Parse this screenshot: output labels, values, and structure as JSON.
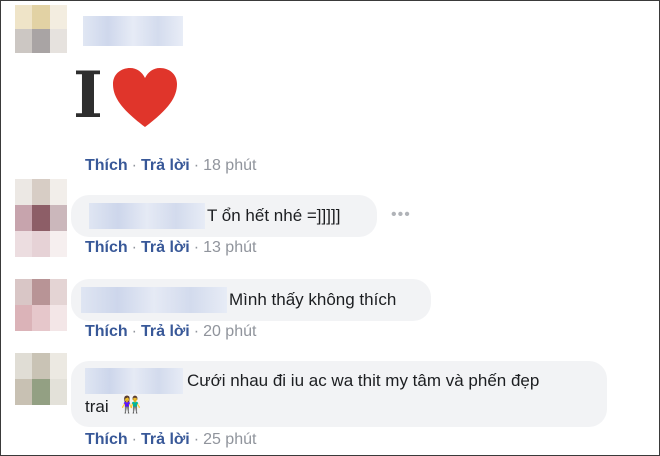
{
  "comments": [
    {
      "text": "",
      "sticker": {
        "letter": "I",
        "heart_color": "#e0352b",
        "icon": "heart-icon"
      },
      "like_label": "Thích",
      "reply_label": "Trả lời",
      "time": "18 phút"
    },
    {
      "text": "T ổn hết nhé =]]]]]",
      "like_label": "Thích",
      "reply_label": "Trả lời",
      "time": "13 phút",
      "more_icon": "more-horizontal-icon"
    },
    {
      "text": "Mình thấy không thích",
      "like_label": "Thích",
      "reply_label": "Trả lời",
      "time": "20 phút"
    },
    {
      "text_line1": "Cưới nhau đi iu ac wa thit my tâm và phến đẹp",
      "text_line2": "trai",
      "emoji": "👫",
      "like_label": "Thích",
      "reply_label": "Trả lời",
      "time": "25 phút"
    }
  ],
  "colors": {
    "link": "#385898",
    "meta": "#90949c",
    "bubble": "#f2f3f5",
    "text": "#1c1e21"
  }
}
